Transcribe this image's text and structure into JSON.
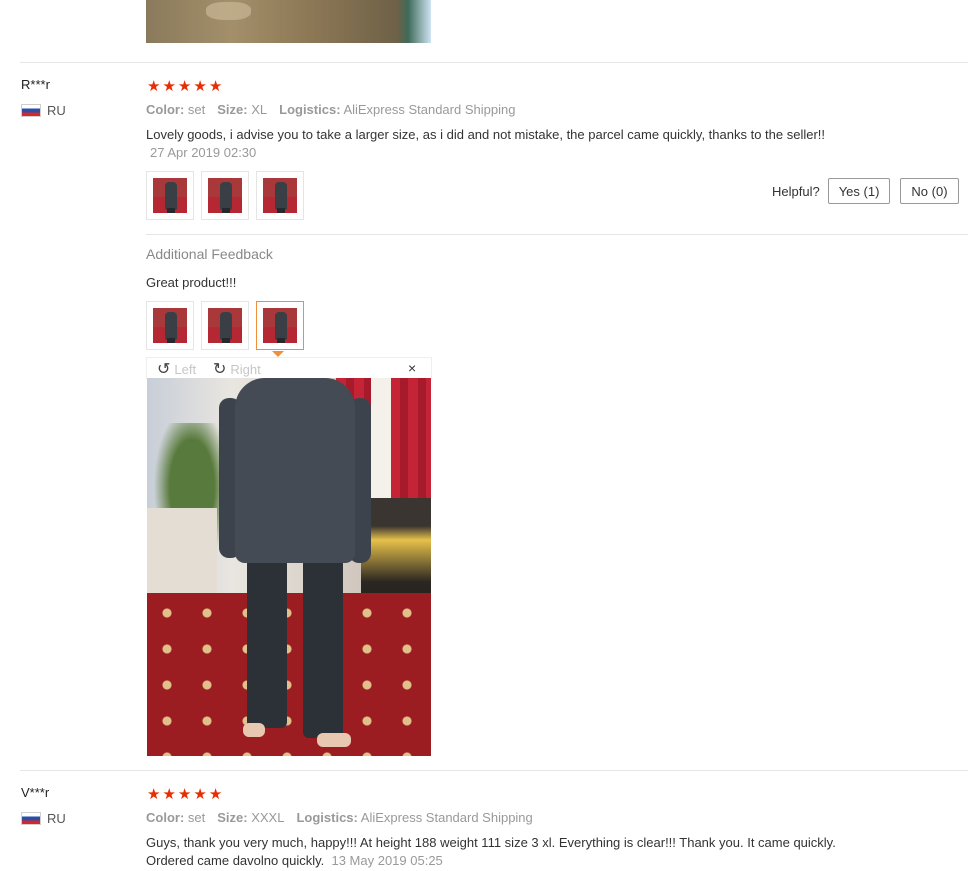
{
  "reviews": [
    {
      "user": "R***r",
      "country": "RU",
      "stars": 5,
      "color_label": "Color:",
      "color_value": "set",
      "size_label": "Size:",
      "size_value": "XL",
      "logistics_label": "Logistics:",
      "logistics_value": "AliExpress Standard Shipping",
      "text": "Lovely goods, i advise you to take a larger size, as i did and not mistake, the parcel came quickly, thanks to the seller!!",
      "date": "27 Apr 2019 02:30",
      "helpful_label": "Helpful?",
      "yes_label": "Yes (1)",
      "no_label": "No (0)",
      "additional_label": "Additional Feedback",
      "additional_text": "Great product!!!",
      "viewer": {
        "left_label": "Left",
        "right_label": "Right",
        "close_label": "×",
        "rotate_left_icon": "↺",
        "rotate_right_icon": "↻"
      }
    },
    {
      "user": "V***r",
      "country": "RU",
      "stars": 5,
      "color_label": "Color:",
      "color_value": "set",
      "size_label": "Size:",
      "size_value": "XXXL",
      "logistics_label": "Logistics:",
      "logistics_value": "AliExpress Standard Shipping",
      "text_line1": "Guys, thank you very much, happy!!! At height 188 weight 111 size 3 xl. Everything is clear!!! Thank you. It came quickly.",
      "text_line2": "Ordered came davolno quickly.",
      "date": "13 May 2019 05:25"
    }
  ],
  "star_glyph": "★",
  "colors": {
    "star": "#e62e04",
    "active_thumb": "#f08f3a"
  }
}
